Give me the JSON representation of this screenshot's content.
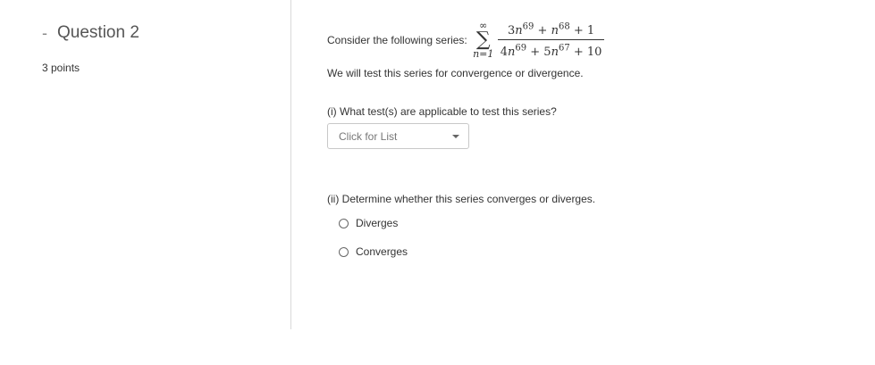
{
  "question": {
    "collapse_symbol": "-",
    "title": "Question 2",
    "points": "3 points"
  },
  "series": {
    "intro": "Consider the following series:",
    "sum_upper": "∞",
    "sum_symbol": "∑",
    "sum_lower": "n=1",
    "numerator": "3n^69 + n^68 + 1",
    "denominator": "4n^69 + 5n^67 + 10"
  },
  "instruction": "We will test this series for convergence or divergence.",
  "part1": {
    "prompt": "(i) What test(s) are applicable to test this series?",
    "dropdown_placeholder": "Click for List"
  },
  "part2": {
    "prompt": "(ii) Determine whether this series converges or diverges.",
    "options": [
      "Diverges",
      "Converges"
    ]
  }
}
